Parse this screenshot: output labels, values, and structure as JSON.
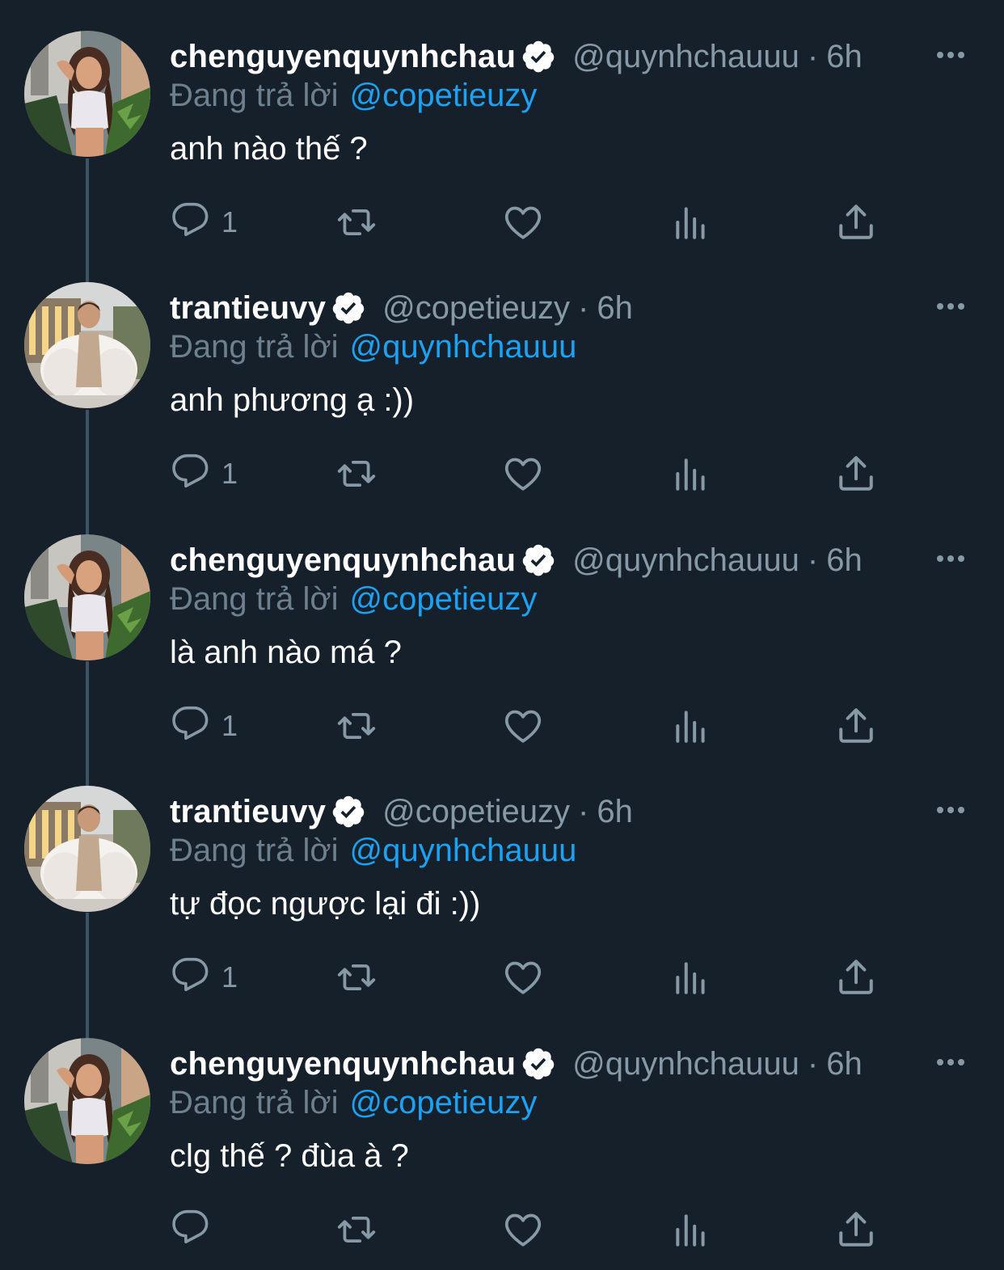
{
  "reply_prefix": "Đang trả lời",
  "tweets": [
    {
      "display_name": "chenguyenquynhchau",
      "handle": "@quynhchauuu",
      "separator": "·",
      "time": "6h",
      "reply_to": "@copetieuzy",
      "text": "anh nào thế ?",
      "reply_count": "1",
      "avatar": "user-a"
    },
    {
      "display_name": "trantieuvy",
      "handle": "@copetieuzy",
      "separator": "·",
      "time": "6h",
      "reply_to": "@quynhchauuu",
      "text": "anh phương ạ :))",
      "reply_count": "1",
      "avatar": "user-b"
    },
    {
      "display_name": "chenguyenquynhchau",
      "handle": "@quynhchauuu",
      "separator": "·",
      "time": "6h",
      "reply_to": "@copetieuzy",
      "text": "là anh nào má ?",
      "reply_count": "1",
      "avatar": "user-a"
    },
    {
      "display_name": "trantieuvy",
      "handle": "@copetieuzy",
      "separator": "·",
      "time": "6h",
      "reply_to": "@quynhchauuu",
      "text": "tự đọc ngược lại đi :))",
      "reply_count": "1",
      "avatar": "user-b"
    },
    {
      "display_name": "chenguyenquynhchau",
      "handle": "@quynhchauuu",
      "separator": "·",
      "time": "6h",
      "reply_to": "@copetieuzy",
      "text": "clg thế ? đùa à ?",
      "reply_count": "",
      "avatar": "user-a"
    }
  ],
  "icons": {
    "reply": "reply-icon",
    "retweet": "retweet-icon",
    "like": "heart-icon",
    "views": "analytics-icon",
    "share": "share-icon",
    "verified": "verified-badge-icon",
    "more": "more-icon"
  },
  "colors": {
    "background": "#15202b",
    "primary_text": "#ffffff",
    "secondary_text": "#8899a6",
    "link": "#1da1f2",
    "thread_line": "#3d5466"
  }
}
